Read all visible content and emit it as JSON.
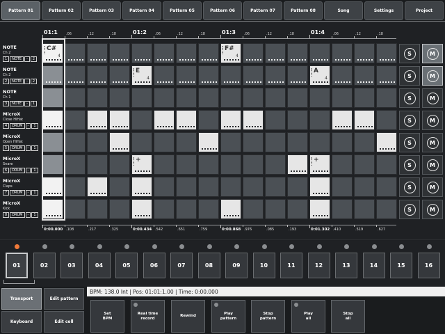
{
  "tabs": [
    "Pattern 01",
    "Pattern 02",
    "Pattern 03",
    "Pattern 04",
    "Pattern 05",
    "Pattern 06",
    "Pattern 07",
    "Pattern 08",
    "Song",
    "Settings",
    "Project"
  ],
  "active_tab": 0,
  "ruler": {
    "majors": [
      "01:1",
      "01:2",
      "01:3",
      "01:4"
    ],
    "minors": [
      ".06",
      ".12",
      ".18"
    ]
  },
  "tracks": [
    {
      "name": "NOTE",
      "sub": "Ch 2",
      "num": "1",
      "type": "NOTE",
      "minus": "-",
      "val": "2"
    },
    {
      "name": "NOTE",
      "sub": "Ch 2",
      "num": "2",
      "type": "NOTE",
      "minus": "-",
      "val": "2"
    },
    {
      "name": "NOTE",
      "sub": "Ch 1",
      "num": "3",
      "type": "NOTE",
      "minus": "-",
      "val": "1"
    },
    {
      "name": "MicroX",
      "sub": "Close HiHat",
      "num": "4",
      "type": "DRUM",
      "minus": "-",
      "val": "1"
    },
    {
      "name": "MicroX",
      "sub": "Open HiHat",
      "num": "5",
      "type": "DRUM",
      "minus": "-",
      "val": "1"
    },
    {
      "name": "MicroX",
      "sub": "Snare",
      "num": "6",
      "type": "DRUM",
      "minus": "-",
      "val": "1"
    },
    {
      "name": "MicroX",
      "sub": "Claps",
      "num": "7",
      "type": "DRUM",
      "minus": "-",
      "val": "1"
    },
    {
      "name": "MicroX",
      "sub": "Kick",
      "num": "8",
      "type": "DRUM",
      "minus": "-",
      "val": "1"
    }
  ],
  "steps": [
    [
      1,
      0,
      0,
      0,
      0,
      0,
      0,
      0,
      0,
      0,
      0,
      0,
      0,
      0,
      0,
      0
    ],
    [
      0,
      0,
      0,
      0,
      0,
      0,
      0,
      0,
      0,
      0,
      0,
      0,
      0,
      0,
      0,
      0
    ],
    [
      0,
      0,
      0,
      0,
      0,
      0,
      0,
      0,
      0,
      0,
      0,
      0,
      0,
      0,
      0,
      0
    ],
    [
      1,
      0,
      1,
      1,
      0,
      1,
      1,
      0,
      1,
      1,
      0,
      0,
      0,
      1,
      1,
      0
    ],
    [
      0,
      0,
      0,
      1,
      0,
      0,
      0,
      1,
      0,
      0,
      0,
      0,
      0,
      0,
      0,
      1
    ],
    [
      0,
      0,
      0,
      0,
      1,
      0,
      0,
      0,
      0,
      0,
      0,
      1,
      1,
      0,
      0,
      0
    ],
    [
      1,
      0,
      1,
      0,
      1,
      0,
      0,
      0,
      0,
      0,
      0,
      0,
      1,
      0,
      0,
      0
    ],
    [
      1,
      0,
      0,
      0,
      1,
      0,
      0,
      0,
      1,
      0,
      0,
      0,
      1,
      0,
      0,
      0
    ]
  ],
  "notes": [
    {
      "track": 0,
      "step": 0,
      "label": "C#",
      "vel": "4"
    },
    {
      "track": 0,
      "step": 8,
      "label": "F#",
      "vel": "4"
    },
    {
      "track": 1,
      "step": 4,
      "label": "E",
      "vel": "4"
    },
    {
      "track": 1,
      "step": 12,
      "label": "A",
      "vel": "4"
    },
    {
      "track": 5,
      "step": 4,
      "label": "+",
      "vel": ""
    },
    {
      "track": 5,
      "step": 12,
      "label": "+",
      "vel": ""
    }
  ],
  "solo_label": "S",
  "mute_label": "M",
  "mute_active": [
    0,
    1
  ],
  "timestamps": [
    {
      "text": "0:00.000",
      "major": true
    },
    {
      "text": ".108",
      "major": false
    },
    {
      "text": ".217",
      "major": false
    },
    {
      "text": ".325",
      "major": false
    },
    {
      "text": "0:00.434",
      "major": true
    },
    {
      "text": ".542",
      "major": false
    },
    {
      "text": ".651",
      "major": false
    },
    {
      "text": ".759",
      "major": false
    },
    {
      "text": "0:00.868",
      "major": true
    },
    {
      "text": ".976",
      "major": false
    },
    {
      "text": ".085",
      "major": false
    },
    {
      "text": ".193",
      "major": false
    },
    {
      "text": "0:01.302",
      "major": true
    },
    {
      "text": ".410",
      "major": false
    },
    {
      "text": ".519",
      "major": false
    },
    {
      "text": ".627",
      "major": false
    }
  ],
  "patterns": [
    "01",
    "02",
    "03",
    "04",
    "05",
    "06",
    "07",
    "08",
    "09",
    "10",
    "11",
    "12",
    "13",
    "14",
    "15",
    "16"
  ],
  "active_pattern": 0,
  "modes": {
    "transport": "Transport",
    "edit_pattern": "Edit pattern",
    "keyboard": "Keyboard",
    "edit_cell": "Edit cell"
  },
  "status": {
    "bpm": "BPM: 138.0 Int",
    "pos": "Pos: 01:01:1.00",
    "time": "Time: 0:00.000"
  },
  "actions": [
    {
      "line1": "Set",
      "line2": "BPM",
      "dot": false
    },
    {
      "line1": "Real time",
      "line2": "record",
      "dot": true
    },
    {
      "line1": "Rewind",
      "line2": "",
      "dot": false
    },
    {
      "line1": "Play",
      "line2": "pattern",
      "dot": true
    },
    {
      "line1": "Stop",
      "line2": "pattern",
      "dot": false
    },
    {
      "line1": "Play",
      "line2": "all",
      "dot": true
    },
    {
      "line1": "Stop",
      "line2": "all",
      "dot": false
    }
  ],
  "colors": {
    "accent_led": "#f07a3a",
    "cell_off": "#4b5055",
    "cell_on": "#e6e6e6"
  }
}
